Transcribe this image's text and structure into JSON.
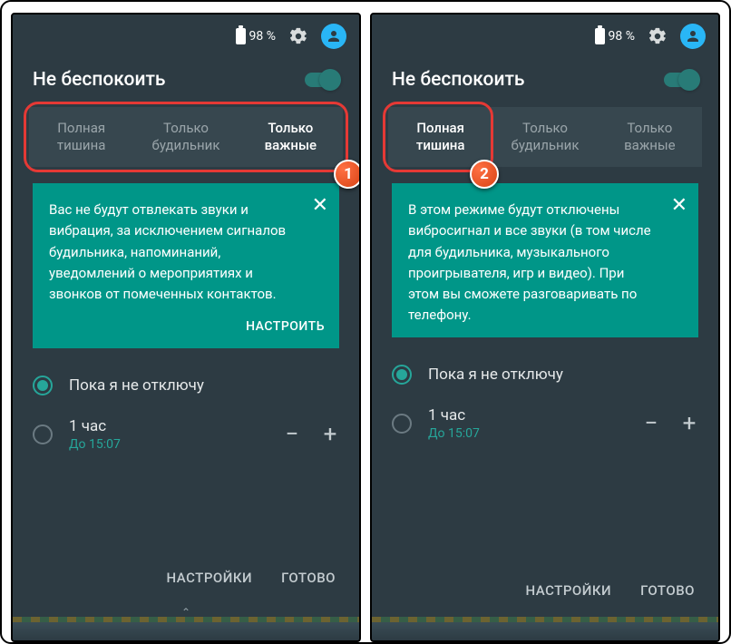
{
  "status": {
    "battery_pct": "98 %"
  },
  "header": {
    "title": "Не беспокоить"
  },
  "tabs": {
    "full_silence": "Полная\nтишина",
    "alarms_only": "Только\nбудильник",
    "priority_only": "Только\nважные"
  },
  "card1": {
    "text": "Вас не будут отвлекать звуки и вибрация, за исключением сигналов будильника, напоминаний, уведомлений о мероприятиях и звонков от помеченных контактов.",
    "action": "НАСТРОИТЬ"
  },
  "card2": {
    "text": "В этом режиме будут отключены вибросигнал и все звуки (в том числе для будильника, музыкального проигрывателя, игр и видео). При этом вы сможете разговаривать по телефону."
  },
  "options": {
    "until_off": "Пока я не отключу",
    "one_hour": "1 час",
    "until_time": "До 15:07"
  },
  "footer": {
    "settings": "НАСТРОЙКИ",
    "done": "ГОТОВО"
  },
  "badges": {
    "one": "1",
    "two": "2"
  }
}
